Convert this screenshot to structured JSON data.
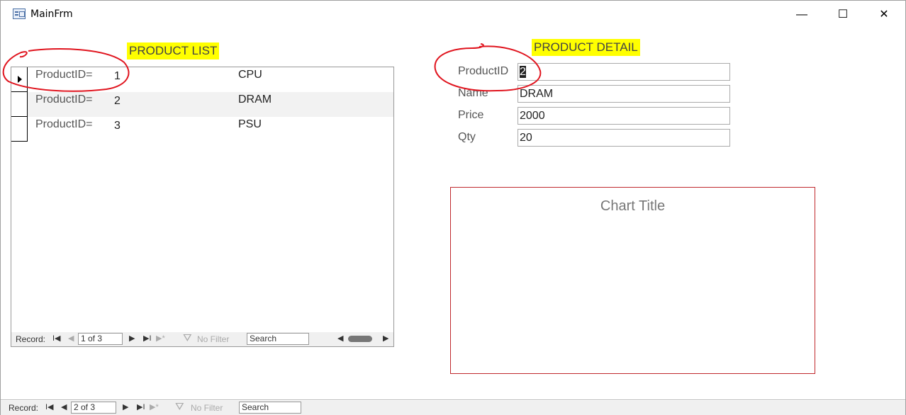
{
  "window": {
    "title": "MainFrm",
    "min": "—",
    "max": "☐",
    "close": "✕"
  },
  "product_list": {
    "heading": "PRODUCT LIST",
    "rows": [
      {
        "label": "ProductID=",
        "id": "1",
        "name": "CPU"
      },
      {
        "label": "ProductID=",
        "id": "2",
        "name": "DRAM"
      },
      {
        "label": "ProductID=",
        "id": "3",
        "name": "PSU"
      }
    ],
    "nav": {
      "record_label": "Record:",
      "position": "1 of 3",
      "filter": "No Filter",
      "search": "Search"
    }
  },
  "product_detail": {
    "heading": "PRODUCT DETAIL",
    "fields": [
      {
        "label": "ProductID",
        "value": "2"
      },
      {
        "label": "Name",
        "value": "DRAM"
      },
      {
        "label": "Price",
        "value": "2000"
      },
      {
        "label": "Qty",
        "value": "20"
      }
    ]
  },
  "chart": {
    "title": "Chart Title"
  },
  "main_nav": {
    "record_label": "Record:",
    "position": "2 of 3",
    "filter": "No Filter",
    "search": "Search"
  },
  "colors": {
    "highlight": "#ffff00",
    "chart_border": "#c0282d",
    "annotation": "#e0141e"
  }
}
